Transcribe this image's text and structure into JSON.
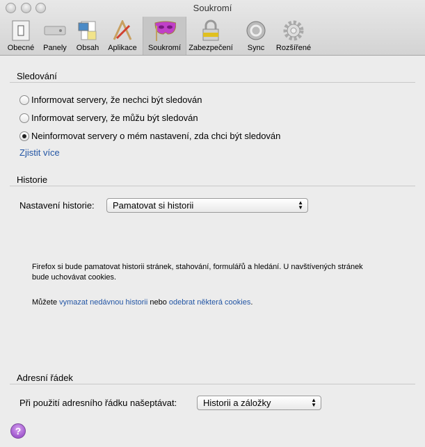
{
  "window": {
    "title": "Soukromí"
  },
  "toolbar": [
    {
      "label": "Obecné",
      "icon": "switch-icon"
    },
    {
      "label": "Panely",
      "icon": "tabs-icon"
    },
    {
      "label": "Obsah",
      "icon": "content-icon"
    },
    {
      "label": "Aplikace",
      "icon": "applications-icon"
    },
    {
      "label": "Soukromí",
      "icon": "mask-icon",
      "selected": true
    },
    {
      "label": "Zabezpečení",
      "icon": "lock-icon"
    },
    {
      "label": "Sync",
      "icon": "sync-icon"
    },
    {
      "label": "Rozšířené",
      "icon": "gear-icon"
    }
  ],
  "tracking": {
    "heading": "Sledování",
    "options": [
      "Informovat servery, že nechci být sledován",
      "Informovat servery, že můžu být sledován",
      "Neinformovat servery o mém nastavení, zda chci být sledován"
    ],
    "selected_index": 2,
    "learn_more": "Zjistit více"
  },
  "history": {
    "heading": "Historie",
    "label": "Nastavení historie:",
    "select_value": "Pamatovat si historii",
    "description": "Firefox si bude pamatovat historii stránek, stahování, formulářů a hledání. U navštívených stránek bude uchovávat cookies.",
    "note_prefix": "Můžete ",
    "link1": "vymazat nedávnou historii",
    "note_mid": " nebo ",
    "link2": "odebrat některá cookies",
    "note_suffix": "."
  },
  "location_bar": {
    "heading": "Adresní řádek",
    "label": "Při použití adresního řádku našeptávat:",
    "select_value": "Historii a záložky"
  },
  "help": {
    "label": "?"
  }
}
